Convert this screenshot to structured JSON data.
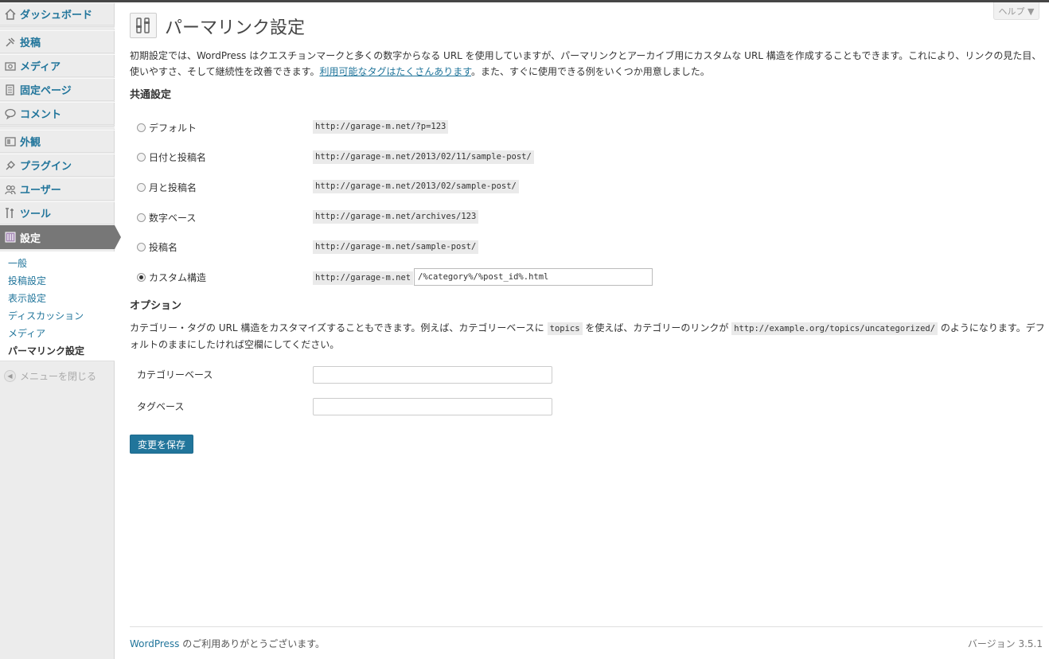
{
  "sidebar": {
    "items": [
      {
        "label": "ダッシュボード",
        "icon": "dashboard-icon"
      },
      {
        "label": "投稿",
        "icon": "pin-icon"
      },
      {
        "label": "メディア",
        "icon": "media-icon"
      },
      {
        "label": "固定ページ",
        "icon": "pages-icon"
      },
      {
        "label": "コメント",
        "icon": "comment-icon"
      },
      {
        "label": "外観",
        "icon": "appearance-icon"
      },
      {
        "label": "プラグイン",
        "icon": "plugin-icon"
      },
      {
        "label": "ユーザー",
        "icon": "users-icon"
      },
      {
        "label": "ツール",
        "icon": "tools-icon"
      },
      {
        "label": "設定",
        "icon": "settings-icon"
      }
    ],
    "submenu": [
      "一般",
      "投稿設定",
      "表示設定",
      "ディスカッション",
      "メディア",
      "パーマリンク設定"
    ],
    "collapse_label": "メニューを閉じる"
  },
  "help_tab": "ヘルプ ▼",
  "page": {
    "title": "パーマリンク設定",
    "intro_before_link": "初期設定では、WordPress はクエスチョンマークと多くの数字からなる URL を使用していますが、パーマリンクとアーカイブ用にカスタムな URL 構造を作成することもできます。これにより、リンクの見た目、使いやすさ、そして継続性を改善できます。",
    "intro_link": "利用可能なタグはたくさんあります",
    "intro_after_link": "。また、すぐに使用できる例をいくつか用意しました。"
  },
  "common": {
    "heading": "共通設定",
    "options": [
      {
        "label": "デフォルト",
        "example": "http://garage-m.net/?p=123"
      },
      {
        "label": "日付と投稿名",
        "example": "http://garage-m.net/2013/02/11/sample-post/"
      },
      {
        "label": "月と投稿名",
        "example": "http://garage-m.net/2013/02/sample-post/"
      },
      {
        "label": "数字ベース",
        "example": "http://garage-m.net/archives/123"
      },
      {
        "label": "投稿名",
        "example": "http://garage-m.net/sample-post/"
      },
      {
        "label": "カスタム構造",
        "example": "http://garage-m.net"
      }
    ],
    "custom_value": "/%category%/%post_id%.html"
  },
  "optional": {
    "heading": "オプション",
    "desc_1": "カテゴリー・タグの URL 構造をカスタマイズすることもできます。例えば、カテゴリーベースに ",
    "desc_code_1": "topics",
    "desc_2": " を使えば、カテゴリーのリンクが ",
    "desc_code_2": "http://example.org/topics/uncategorized/",
    "desc_3": " のようになります。デフォルトのままにしたければ空欄にしてください。",
    "category_base_label": "カテゴリーベース",
    "tag_base_label": "タグベース",
    "category_base_value": "",
    "tag_base_value": ""
  },
  "save_button": "変更を保存",
  "footer": {
    "wp_link": "WordPress",
    "thanks": " のご利用ありがとうございます。",
    "version": "バージョン 3.5.1"
  },
  "colors": {
    "accent": "#21759b",
    "sidebar_bg": "#ececec",
    "active_bg": "#777777"
  }
}
